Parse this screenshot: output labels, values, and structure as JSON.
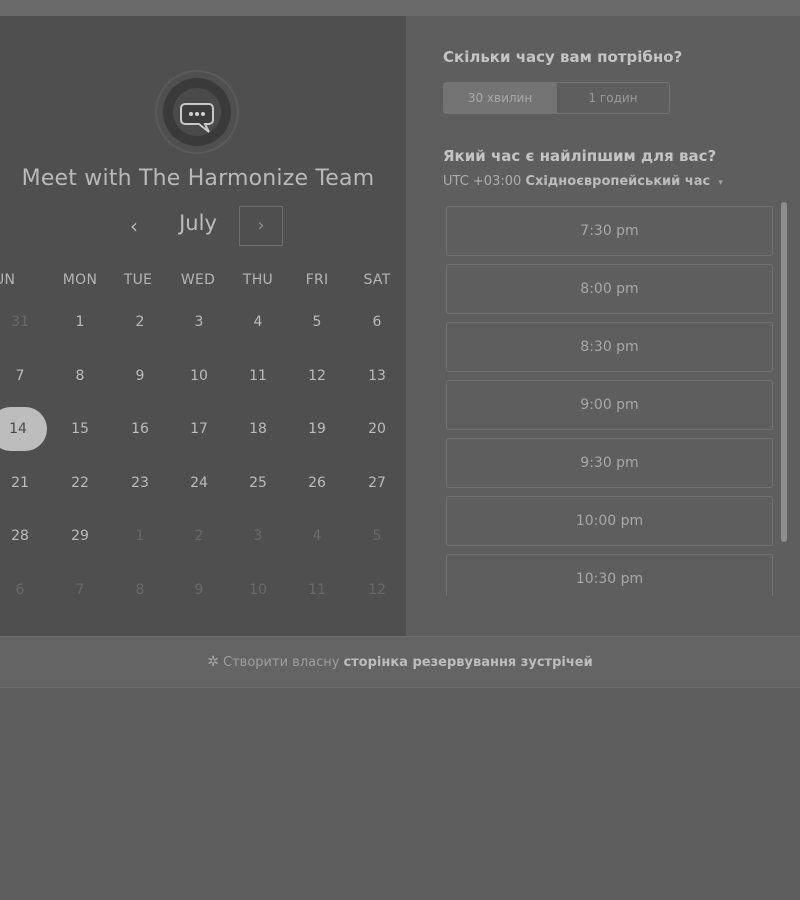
{
  "host": {
    "title": "Meet with The Harmonize Team",
    "avatar_icon": "chat-bubble-icon"
  },
  "calendar": {
    "month": "July",
    "prev_icon": "chevron-left-icon",
    "next_icon": "chevron-right-icon",
    "prev_glyph": "‹",
    "next_glyph": "›",
    "weekdays": [
      "SUN",
      "MON",
      "TUE",
      "WED",
      "THU",
      "FRI",
      "SAT"
    ],
    "sunday_visible_label": "UN",
    "weeks": [
      [
        {
          "d": "31",
          "muted": true
        },
        {
          "d": "1"
        },
        {
          "d": "2"
        },
        {
          "d": "3"
        },
        {
          "d": "4"
        },
        {
          "d": "5"
        },
        {
          "d": "6"
        }
      ],
      [
        {
          "d": "7"
        },
        {
          "d": "8"
        },
        {
          "d": "9"
        },
        {
          "d": "10"
        },
        {
          "d": "11"
        },
        {
          "d": "12"
        },
        {
          "d": "13"
        }
      ],
      [
        {
          "d": "14",
          "selected": true
        },
        {
          "d": "15"
        },
        {
          "d": "16"
        },
        {
          "d": "17"
        },
        {
          "d": "18"
        },
        {
          "d": "19"
        },
        {
          "d": "20"
        }
      ],
      [
        {
          "d": "21"
        },
        {
          "d": "22"
        },
        {
          "d": "23"
        },
        {
          "d": "24"
        },
        {
          "d": "25"
        },
        {
          "d": "26"
        },
        {
          "d": "27"
        }
      ],
      [
        {
          "d": "28"
        },
        {
          "d": "29"
        },
        {
          "d": "1",
          "muted": true
        },
        {
          "d": "2",
          "muted": true
        },
        {
          "d": "3",
          "muted": true
        },
        {
          "d": "4",
          "muted": true
        },
        {
          "d": "5",
          "muted": true
        }
      ],
      [
        {
          "d": "6",
          "muted": true
        },
        {
          "d": "7",
          "muted": true
        },
        {
          "d": "8",
          "muted": true
        },
        {
          "d": "9",
          "muted": true
        },
        {
          "d": "10",
          "muted": true
        },
        {
          "d": "11",
          "muted": true
        },
        {
          "d": "12",
          "muted": true
        }
      ]
    ]
  },
  "duration": {
    "question": "Скільки часу вам потрібно?",
    "options": [
      "30 хвилин",
      "1 годин"
    ],
    "selected": "30 хвилин"
  },
  "time": {
    "question": "Який час є найліпшим для вас?",
    "tz_prefix": "UTC +03:00",
    "tz_name": "Східноєвропейський час",
    "tz_caret": "▾",
    "slots": [
      "7:30 pm",
      "8:00 pm",
      "8:30 pm",
      "9:00 pm",
      "9:30 pm",
      "10:00 pm",
      "10:30 pm"
    ]
  },
  "footer": {
    "sprocket_icon": "hubspot-sprocket-icon",
    "sprocket_glyph": "✲",
    "prefix": "Створити власну",
    "link": "сторінка резервування зустрічей"
  }
}
